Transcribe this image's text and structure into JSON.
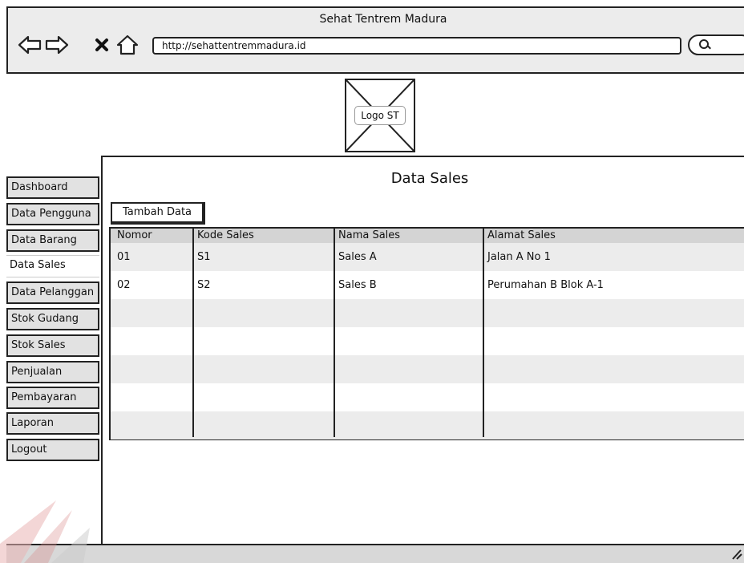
{
  "window": {
    "title": "Sehat Tentrem Madura"
  },
  "browser": {
    "url": "http://sehattentremmadura.id",
    "nav_icons": [
      "back-arrow-icon",
      "forward-arrow-icon",
      "close-icon",
      "home-icon"
    ],
    "search_icon": "search-icon"
  },
  "header": {
    "logo_label": "Logo ST"
  },
  "sidebar": {
    "items": [
      {
        "label": "Dashboard"
      },
      {
        "label": "Data Pengguna"
      },
      {
        "label": "Data Barang"
      },
      {
        "label": "Data Sales",
        "active": true
      },
      {
        "label": "Data Pelanggan"
      },
      {
        "label": "Stok Gudang"
      },
      {
        "label": "Stok Sales"
      },
      {
        "label": "Penjualan"
      },
      {
        "label": "Pembayaran"
      },
      {
        "label": "Laporan"
      },
      {
        "label": "Logout"
      }
    ]
  },
  "main": {
    "title": "Data Sales",
    "add_button": "Tambah Data",
    "table": {
      "columns": [
        "Nomor",
        "Kode Sales",
        "Nama Sales",
        "Alamat Sales"
      ],
      "rows": [
        [
          "01",
          "S1",
          "Sales A",
          "Jalan A No 1"
        ],
        [
          "02",
          "S2",
          "Sales B",
          "Perumahan B Blok A-1"
        ]
      ]
    }
  },
  "colors": {
    "chrome": "#ececec",
    "sidebar_item": "#e2e2e2",
    "header_row": "#d4d4d4",
    "stroke": "#222222"
  }
}
